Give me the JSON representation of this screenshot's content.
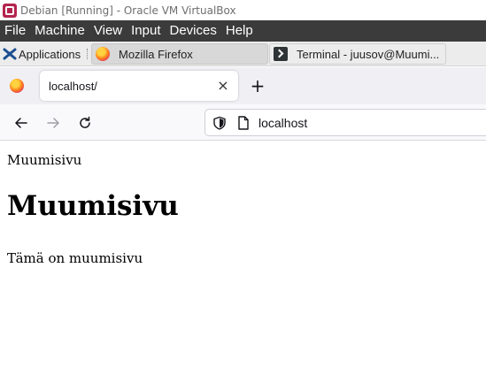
{
  "vbox": {
    "window_title": "Debian [Running] - Oracle VM VirtualBox",
    "menu": [
      "File",
      "Machine",
      "View",
      "Input",
      "Devices",
      "Help"
    ]
  },
  "panel": {
    "applications_label": "Applications",
    "tasks": [
      {
        "label": "Mozilla Firefox",
        "icon": "firefox-icon",
        "active": true
      },
      {
        "label": "Terminal - juusov@Muumi...",
        "icon": "terminal-icon",
        "active": false
      }
    ]
  },
  "browser": {
    "tab_title": "localhost/",
    "url": "localhost",
    "new_tab_glyph": "+",
    "close_glyph": "×"
  },
  "page": {
    "site_name": "Muumisivu",
    "heading": "Muumisivu",
    "paragraph": "Tämä on muumisivu"
  },
  "colors": {
    "vbox_menubar_bg": "#3b3b3b",
    "vbox_logo": "#b3244e",
    "firefox_tabstrip": "#f0f0f4"
  }
}
